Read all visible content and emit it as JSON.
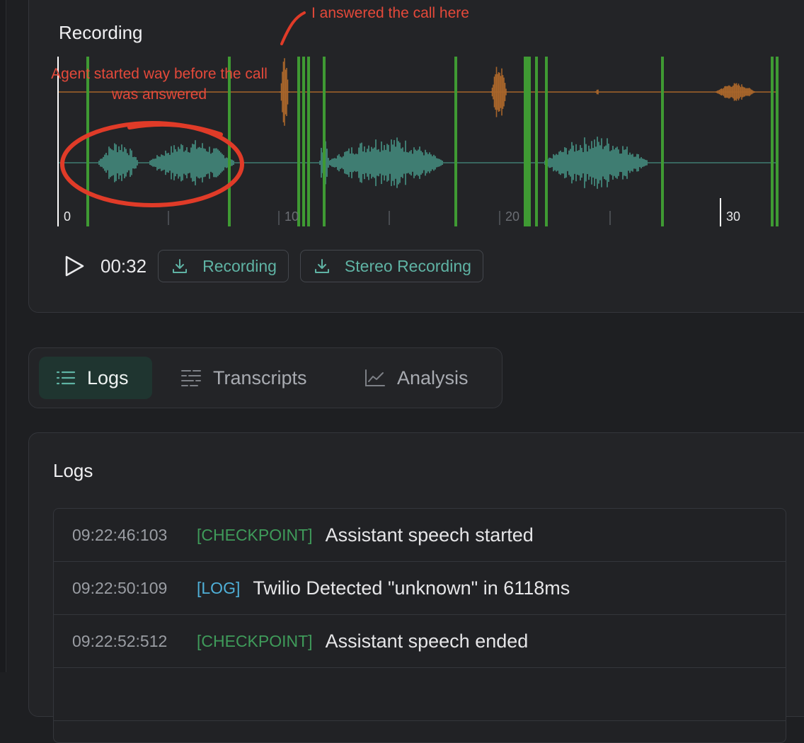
{
  "recording": {
    "title": "Recording",
    "time": "00:32",
    "download_label": "Recording",
    "stereo_download_label": "Stereo Recording",
    "timeline_ticks": [
      "0",
      "10",
      "20",
      "30"
    ],
    "colors": {
      "top_channel": "#a8652a",
      "bottom_channel": "#3f7d72",
      "markers": "#3f9a33",
      "playhead": "#ffffff"
    }
  },
  "annotations": {
    "answered": "I  answered the call here",
    "agent_started": "Agent started way before the call was answered"
  },
  "tabs": [
    {
      "label": "Logs",
      "icon": "list-icon",
      "active": true
    },
    {
      "label": "Transcripts",
      "icon": "transcript-icon",
      "active": false
    },
    {
      "label": "Analysis",
      "icon": "chart-icon",
      "active": false
    }
  ],
  "logs": {
    "title": "Logs",
    "rows": [
      {
        "timestamp": "09:22:46:103",
        "tag": "[CHECKPOINT]",
        "tag_color": "#3f9b5a",
        "message": "Assistant speech started"
      },
      {
        "timestamp": "09:22:50:109",
        "tag": "[LOG]",
        "tag_color": "#4fb0d8",
        "message": "Twilio Detected \"unknown\" in 6118ms"
      },
      {
        "timestamp": "09:22:52:512",
        "tag": "[CHECKPOINT]",
        "tag_color": "#3f9b5a",
        "message": "Assistant speech ended"
      }
    ]
  }
}
